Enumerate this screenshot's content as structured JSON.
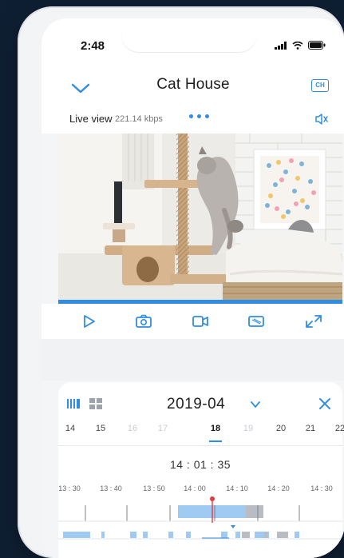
{
  "status": {
    "time": "2:48"
  },
  "header": {
    "title": "Cat House",
    "channel_label": "CH"
  },
  "live": {
    "label": "Live view",
    "bitrate": "221.14 kbps"
  },
  "controls": [
    {
      "name": "play-icon"
    },
    {
      "name": "camera-icon"
    },
    {
      "name": "record-icon"
    },
    {
      "name": "screen-icon"
    },
    {
      "name": "fullscreen-icon"
    }
  ],
  "sheet": {
    "month": "2019-04",
    "days": [
      "14",
      "15",
      "16",
      "17",
      "18",
      "19",
      "20",
      "21",
      "22"
    ],
    "selected_day": "18",
    "current_time": "14 : 01 : 35",
    "ticks": [
      "13 : 30",
      "13 : 40",
      "13 : 50",
      "14 : 00",
      "14 : 10",
      "14 : 20",
      "14 : 30"
    ]
  },
  "colors": {
    "accent": "#2f8de4",
    "recording": "#9fcaf1",
    "marker": "#e23b3b"
  }
}
